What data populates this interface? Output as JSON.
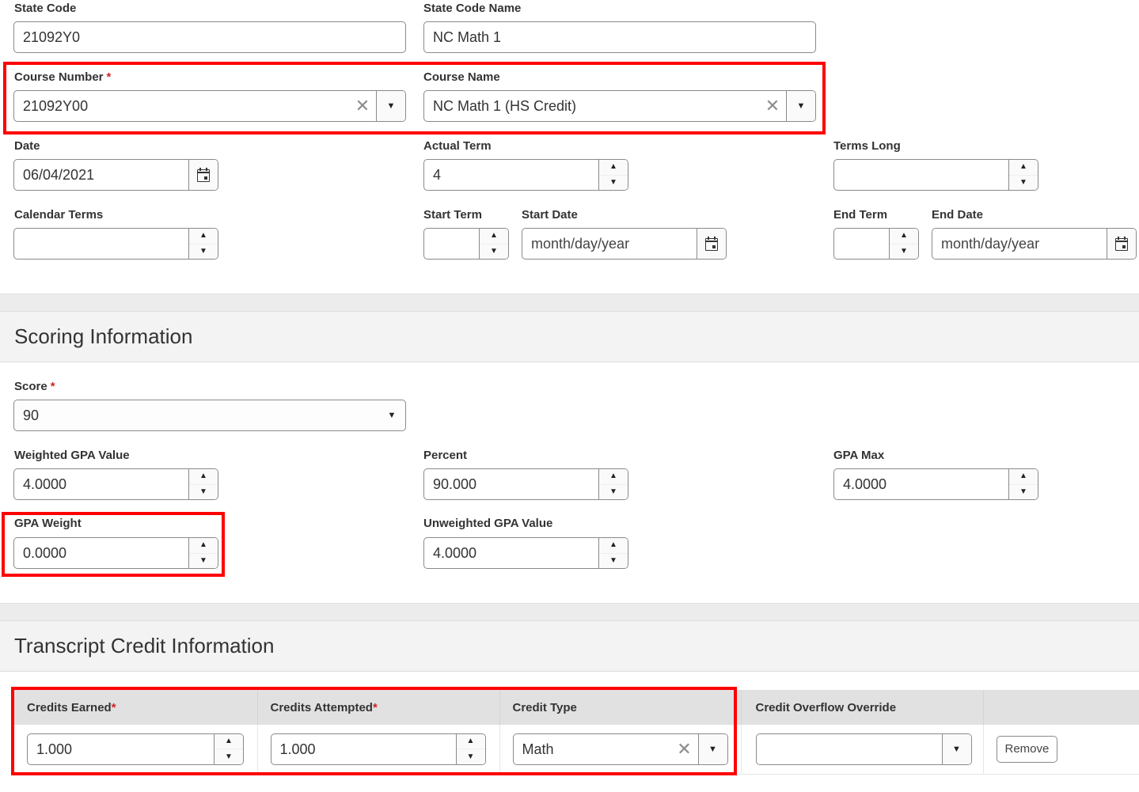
{
  "general": {
    "state_code": {
      "label": "State Code",
      "value": "21092Y0"
    },
    "state_code_name": {
      "label": "State Code Name",
      "value": "NC Math 1"
    },
    "course_number": {
      "label": "Course Number",
      "required": "*",
      "value": "21092Y00"
    },
    "course_name": {
      "label": "Course Name",
      "value": "NC Math 1 (HS Credit)"
    },
    "date": {
      "label": "Date",
      "value": "06/04/2021"
    },
    "actual_term": {
      "label": "Actual Term",
      "value": "4"
    },
    "terms_long": {
      "label": "Terms Long",
      "value": ""
    },
    "calendar_terms": {
      "label": "Calendar Terms",
      "value": ""
    },
    "start_term": {
      "label": "Start Term",
      "value": ""
    },
    "start_date": {
      "label": "Start Date",
      "placeholder": "month/day/year"
    },
    "end_term": {
      "label": "End Term",
      "value": ""
    },
    "end_date": {
      "label": "End Date",
      "placeholder": "month/day/year"
    }
  },
  "scoring": {
    "title": "Scoring Information",
    "score": {
      "label": "Score",
      "required": "*",
      "value": "90"
    },
    "weighted_gpa_value": {
      "label": "Weighted GPA Value",
      "value": "4.0000"
    },
    "percent": {
      "label": "Percent",
      "value": "90.000"
    },
    "gpa_max": {
      "label": "GPA Max",
      "value": "4.0000"
    },
    "gpa_weight": {
      "label": "GPA Weight",
      "value": "0.0000"
    },
    "unweighted_gpa_value": {
      "label": "Unweighted GPA Value",
      "value": "4.0000"
    }
  },
  "transcript_credit": {
    "title": "Transcript Credit Information",
    "columns": [
      {
        "label": "Credits Earned",
        "required": "*"
      },
      {
        "label": "Credits Attempted",
        "required": "*"
      },
      {
        "label": "Credit Type",
        "required": ""
      },
      {
        "label": "Credit Overflow Override",
        "required": ""
      },
      {
        "label": "",
        "required": ""
      }
    ],
    "row": {
      "credits_earned": "1.000",
      "credits_attempted": "1.000",
      "credit_type": "Math",
      "credit_overflow_override": "",
      "remove_label": "Remove"
    }
  },
  "icons": {
    "clear": "✕",
    "dropdown": "▼",
    "spin_up": "▲",
    "spin_down": "▼"
  },
  "colors": {
    "highlight": "#ff0000",
    "required": "#d0231f",
    "section_bg": "#f3f3f3",
    "table_header_bg": "#e1e1e1"
  }
}
